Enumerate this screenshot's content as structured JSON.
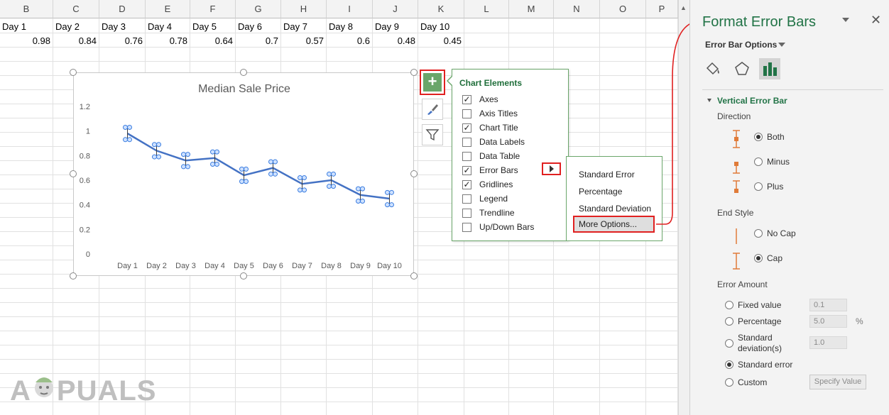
{
  "sheet": {
    "columns": [
      "B",
      "C",
      "D",
      "E",
      "F",
      "G",
      "H",
      "I",
      "J",
      "K",
      "L",
      "M",
      "N",
      "O",
      "P"
    ],
    "header_row": [
      "Day 1",
      "Day 2",
      "Day 3",
      "Day 4",
      "Day 5",
      "Day 6",
      "Day 7",
      "Day 8",
      "Day 9",
      "Day 10"
    ],
    "value_row": [
      "0.98",
      "0.84",
      "0.76",
      "0.78",
      "0.64",
      "0.7",
      "0.57",
      "0.6",
      "0.48",
      "0.45"
    ]
  },
  "chart_data": {
    "type": "line",
    "title": "Median Sale Price",
    "categories": [
      "Day 1",
      "Day 2",
      "Day 3",
      "Day 4",
      "Day 5",
      "Day 6",
      "Day 7",
      "Day 8",
      "Day 9",
      "Day 10"
    ],
    "values": [
      0.98,
      0.84,
      0.76,
      0.78,
      0.64,
      0.7,
      0.57,
      0.6,
      0.48,
      0.45
    ],
    "ylim": [
      0,
      1.2
    ],
    "yticks": [
      "0",
      "0.2",
      "0.4",
      "0.6",
      "0.8",
      "1",
      "1.2"
    ],
    "error_bars": "both directions with cap",
    "gridlines": false,
    "line_color": "#4472c4"
  },
  "chart_elements": {
    "title": "Chart Elements",
    "items": [
      {
        "label": "Axes",
        "checked": true
      },
      {
        "label": "Axis Titles",
        "checked": false
      },
      {
        "label": "Chart Title",
        "checked": true
      },
      {
        "label": "Data Labels",
        "checked": false
      },
      {
        "label": "Data Table",
        "checked": false
      },
      {
        "label": "Error Bars",
        "checked": true
      },
      {
        "label": "Gridlines",
        "checked": true
      },
      {
        "label": "Legend",
        "checked": false
      },
      {
        "label": "Trendline",
        "checked": false
      },
      {
        "label": "Up/Down Bars",
        "checked": false
      }
    ]
  },
  "error_bars_submenu": {
    "items": [
      "Standard Error",
      "Percentage",
      "Standard Deviation"
    ],
    "more_options": "More Options..."
  },
  "format_pane": {
    "title": "Format Error Bars",
    "options_label": "Error Bar Options",
    "section": "Vertical Error Bar",
    "direction_label": "Direction",
    "direction_options": [
      "Both",
      "Minus",
      "Plus"
    ],
    "direction_selected": "Both",
    "end_style_label": "End Style",
    "end_style_options": [
      "No Cap",
      "Cap"
    ],
    "end_style_selected": "Cap",
    "error_amount_label": "Error Amount",
    "fixed_value_label": "Fixed value",
    "fixed_value": "0.1",
    "percentage_label": "Percentage",
    "percentage_value": "5.0",
    "percent_sign": "%",
    "std_dev_label_1": "Standard",
    "std_dev_label_2": "deviation(s)",
    "std_dev_value": "1.0",
    "std_error_label": "Standard error",
    "custom_label": "Custom",
    "specify_value_label": "Specify Value",
    "accent_color": "#217346",
    "highlight_color": "#e02020"
  },
  "watermark": {
    "text_left": "A",
    "text_right": "PUALS"
  }
}
